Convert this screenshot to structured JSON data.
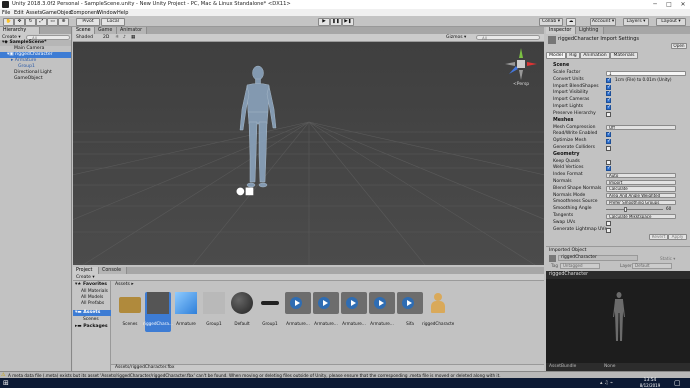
{
  "window": {
    "title": "Unity 2018.3.0f2 Personal - SampleScene.unity - New Unity Project - PC, Mac & Linux Standalone* <DX11>",
    "minimize": "─",
    "maximize": "□",
    "close": "✕"
  },
  "menubar": [
    "File",
    "Edit",
    "Assets",
    "GameObject",
    "Component",
    "Window",
    "Help"
  ],
  "toolbar": {
    "pivot": "Pivot",
    "local": "Local",
    "play": "▶",
    "pause": "❚❚",
    "step": "▶❚",
    "collab": "Collab ▾",
    "account": "Account ▾",
    "layers": "Layers ▾",
    "layout": "Layout ▾"
  },
  "hierarchy": {
    "tab": "Hierarchy",
    "create": "Create ▾",
    "search_placeholder": "All",
    "items": [
      {
        "label": "SampleScene*",
        "level": 0
      },
      {
        "label": "Main Camera",
        "level": 1
      },
      {
        "label": "riggedCharacter",
        "level": 1
      },
      {
        "label": "Armature",
        "level": 2
      },
      {
        "label": "Group1",
        "level": 2
      },
      {
        "label": "Directional Light",
        "level": 1
      },
      {
        "label": "GameObject",
        "level": 1
      }
    ]
  },
  "scene": {
    "tabs": [
      "Scene",
      "Game",
      "Animator"
    ],
    "shaded": "Shaded",
    "mode2d": "2D",
    "gizmos": "Gizmos ▾",
    "search_placeholder": "All",
    "persp": "<Persp"
  },
  "project": {
    "tabs": [
      "Project",
      "Console"
    ],
    "create": "Create ▾",
    "favorites": "Favorites",
    "fav_items": [
      "All Materials",
      "All Models",
      "All Prefabs"
    ],
    "assets_root": "Assets",
    "asset_folders": [
      "Scenes"
    ],
    "packages": "Packages",
    "breadcrumb": "Assets ▸",
    "assets": [
      "Scenes",
      "riggedChara...",
      "Armature",
      "Group1",
      "Default",
      "Group1",
      "Armature...",
      "Armature...",
      "Armature...",
      "Armature...",
      "Sifa",
      "riggedCharacter"
    ],
    "selected_path": "Assets/riggedCharacter.fbx"
  },
  "inspector": {
    "tabs": [
      "Inspector",
      "Lighting"
    ],
    "title": "riggedCharacter Import Settings",
    "open": "Open",
    "subtabs": [
      "Model",
      "Rig",
      "Animation",
      "Materials"
    ],
    "scene_header": "Scene",
    "scale_factor_label": "Scale Factor",
    "scale_factor": "1",
    "convert_units_label": "Convert Units",
    "convert_units_hint": "1cm (File) to 0.01m (Unity)",
    "import_blendshapes": "Import BlendShapes",
    "import_visibility": "Import Visibility",
    "import_cameras": "Import Cameras",
    "import_lights": "Import Lights",
    "preserve_hierarchy": "Preserve Hierarchy",
    "meshes_header": "Meshes",
    "mesh_compression_label": "Mesh Compression",
    "mesh_compression": "Off",
    "read_write_label": "Read/Write Enabled",
    "optimize_mesh_label": "Optimize Mesh",
    "generate_colliders_label": "Generate Colliders",
    "geometry_header": "Geometry",
    "keep_quads": "Keep Quads",
    "weld_vertices": "Weld Vertices",
    "index_format_label": "Index Format",
    "index_format": "Auto",
    "normals_label": "Normals",
    "normals": "Import",
    "blend_normals_label": "Blend Shape Normals",
    "blend_normals": "Calculate",
    "normals_mode_label": "Normals Mode",
    "normals_mode": "Area And Angle Weighted",
    "smoothness_label": "Smoothness Source",
    "smoothness": "Prefer Smoothing Groups",
    "smoothing_angle_label": "Smoothing Angle",
    "smoothing_angle": "60",
    "tangents_label": "Tangents",
    "tangents": "Calculate Mikktspace",
    "swap_uvs": "Swap UVs",
    "lightmap_uvs": "Generate Lightmap UVs",
    "revert": "Revert",
    "apply": "Apply",
    "imported_object": "Imported Object",
    "imported_name": "riggedCharacter",
    "static_label": "Static ▾",
    "tag_label": "Tag",
    "tag": "Untagged",
    "layer_label": "Layer",
    "layer": "Default"
  },
  "preview": {
    "title": "riggedCharacter",
    "assetbundle": "AssetBundle",
    "none": "None"
  },
  "status": "A meta data file (.meta) exists but its asset 'Assets/riggedCharacter/riggedCharacter.fbx' can't be found. When moving or deleting files outside of Unity, please ensure that the corresponding .meta file is moved or deleted along with it.",
  "taskbar": {
    "time": "13:54",
    "date": "8/12/2019"
  }
}
